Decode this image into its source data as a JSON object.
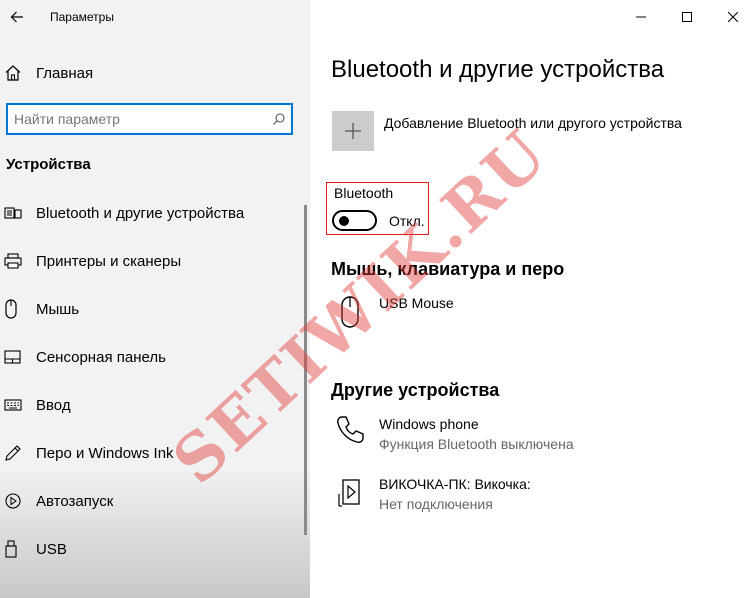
{
  "window": {
    "title": "Параметры",
    "controls": [
      "minimize-icon",
      "maximize-icon",
      "close-icon"
    ]
  },
  "sidebar": {
    "home_label": "Главная",
    "search_placeholder": "Найти параметр",
    "section_title": "Устройства",
    "items": [
      {
        "label": "Bluetooth и другие устройства",
        "icon": "bluetooth-devices-icon"
      },
      {
        "label": "Принтеры и сканеры",
        "icon": "printer-icon"
      },
      {
        "label": "Мышь",
        "icon": "mouse-icon"
      },
      {
        "label": "Сенсорная панель",
        "icon": "touchpad-icon"
      },
      {
        "label": "Ввод",
        "icon": "keyboard-icon"
      },
      {
        "label": "Перо и Windows Ink",
        "icon": "pen-icon"
      },
      {
        "label": "Автозапуск",
        "icon": "autoplay-icon"
      },
      {
        "label": "USB",
        "icon": "usb-icon"
      }
    ]
  },
  "main": {
    "title": "Bluetooth и другие устройства",
    "add_device_label": "Добавление Bluetooth или другого устройства",
    "bluetooth": {
      "label": "Bluetooth",
      "toggle_state": "Откл.",
      "enabled": false
    },
    "mouse_section_title": "Мышь, клавиатура и перо",
    "mouse_devices": [
      {
        "name": "USB Mouse",
        "status": "",
        "icon": "mouse-icon"
      }
    ],
    "other_section_title": "Другие устройства",
    "other_devices": [
      {
        "name": "Windows phone",
        "status": "Функция Bluetooth выключена",
        "icon": "phone-icon"
      },
      {
        "name": "ВИКОЧКА-ПК: Викочка:",
        "status": "Нет подключения",
        "icon": "media-device-icon"
      }
    ]
  },
  "watermark": "SETIWIK.RU",
  "colors": {
    "accent": "#0078d7",
    "highlight_border": "#e21b1b",
    "sidebar_bg": "#f2f2f2",
    "add_tile": "#cccccc"
  }
}
